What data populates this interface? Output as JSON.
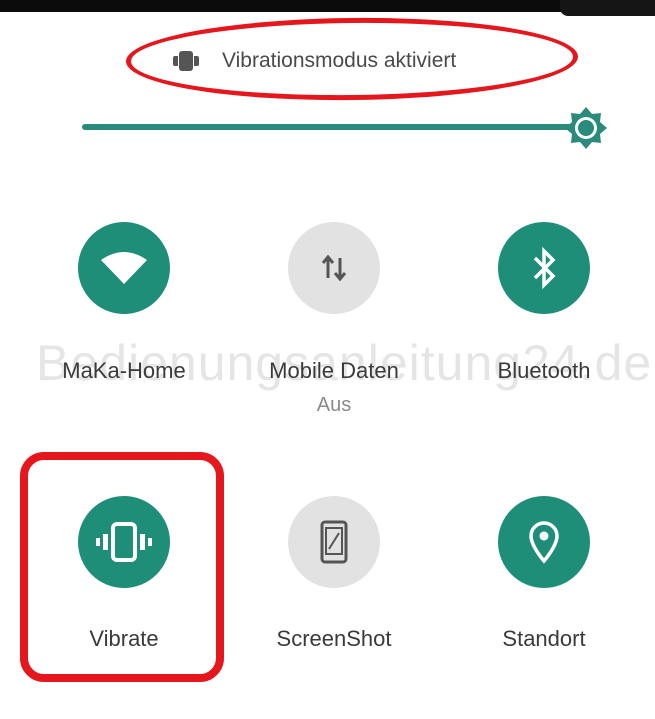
{
  "status": {
    "text": "Vibrationsmodus aktiviert"
  },
  "brightness": {
    "level_fraction": 1.0
  },
  "watermark": "Bedienungsanleitung24.de",
  "tiles": [
    {
      "label": "MaKa-Home",
      "sublabel": "",
      "icon": "wifi-icon",
      "active": true
    },
    {
      "label": "Mobile Daten",
      "sublabel": "Aus",
      "icon": "mobile-data-icon",
      "active": false
    },
    {
      "label": "Bluetooth",
      "sublabel": "",
      "icon": "bluetooth-icon",
      "active": true
    },
    {
      "label": "Vibrate",
      "sublabel": "",
      "icon": "vibrate-icon",
      "active": true
    },
    {
      "label": "ScreenShot",
      "sublabel": "",
      "icon": "screenshot-icon",
      "active": false
    },
    {
      "label": "Standort",
      "sublabel": "",
      "icon": "location-icon",
      "active": true
    }
  ],
  "colors": {
    "accent": "#1e8e79",
    "inactive": "#e2e2e2",
    "highlight": "#e5171c"
  }
}
